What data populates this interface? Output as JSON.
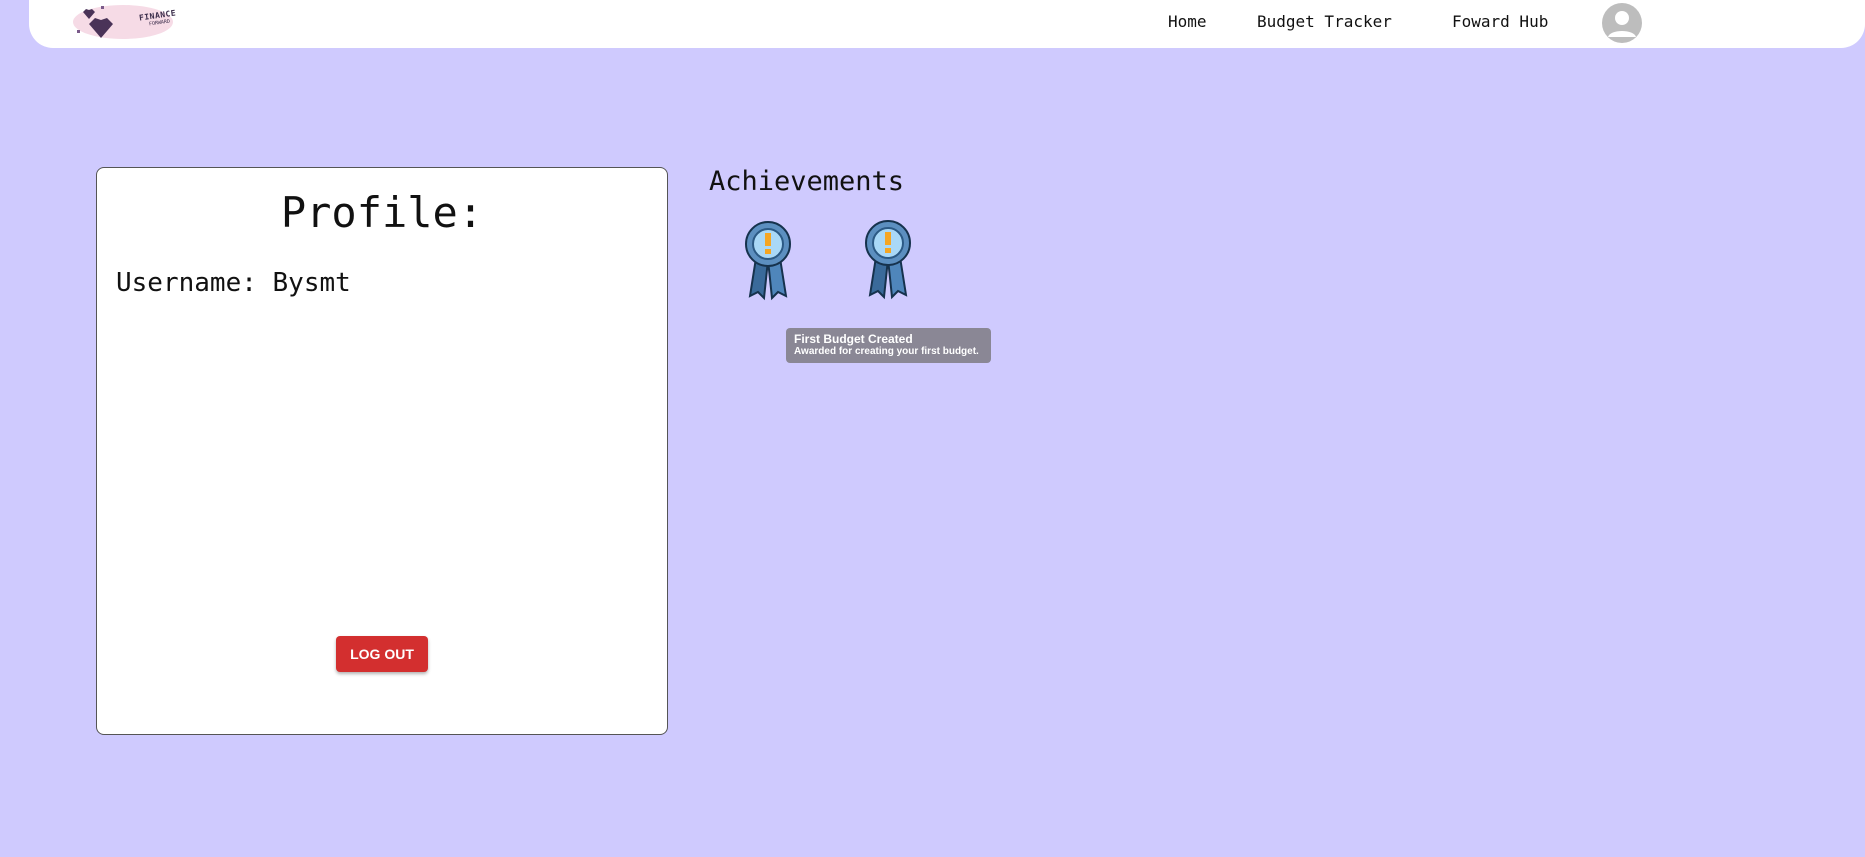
{
  "nav": {
    "logo_text": "FINANCE",
    "logo_sub": "FORWARD",
    "links": [
      "Home",
      "Budget Tracker",
      "Foward Hub"
    ],
    "avatar_icon": "account-circle-icon"
  },
  "profile": {
    "title": "Profile:",
    "username_line": "Username: Bysmt",
    "logout_label": "LOG OUT"
  },
  "achievements": {
    "title": "Achievements",
    "badges": [
      {
        "icon": "ribbon-medal-icon"
      },
      {
        "icon": "ribbon-medal-icon"
      }
    ],
    "tooltip": {
      "title": "First Budget Created",
      "description": "Awarded for creating your first budget."
    }
  },
  "colors": {
    "background": "#cfcafe",
    "logout": "#d32f2f",
    "medal": "#9fd3f5"
  }
}
